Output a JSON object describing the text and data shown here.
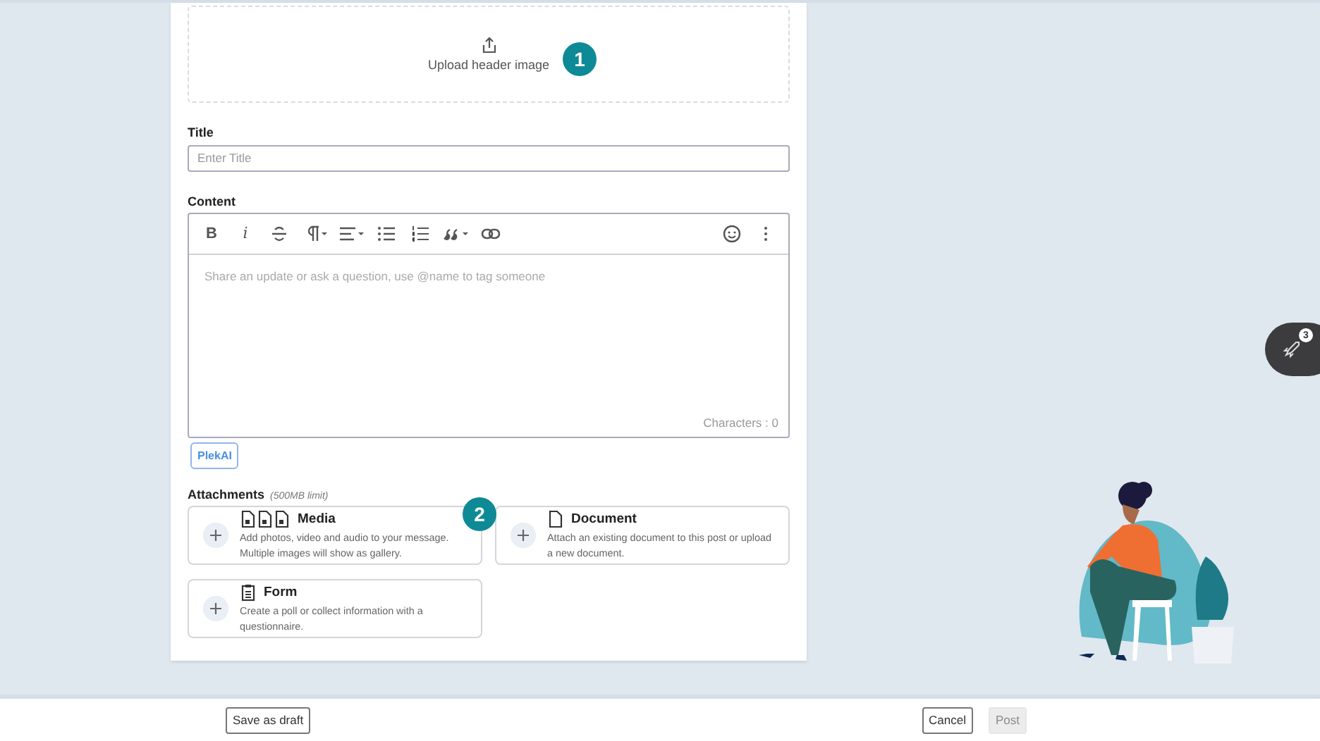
{
  "upload": {
    "label": "Upload header image",
    "step": "1"
  },
  "title_field": {
    "label": "Title",
    "placeholder": "Enter Title"
  },
  "content": {
    "label": "Content",
    "toolbar": [
      {
        "kind": "bold",
        "label": "B"
      },
      {
        "kind": "italic",
        "label": "i"
      },
      {
        "kind": "strike"
      },
      {
        "kind": "paragraph"
      },
      {
        "kind": "align"
      },
      {
        "kind": "bullets"
      },
      {
        "kind": "numbers"
      },
      {
        "kind": "quote"
      },
      {
        "kind": "link"
      },
      {
        "kind": "emoji"
      },
      {
        "kind": "more"
      }
    ],
    "placeholder": "Share an update or ask a question, use @name to tag someone",
    "counter": "Characters : 0"
  },
  "ai_button": "PlekAI",
  "attachments": {
    "label": "Attachments",
    "note": "(500MB limit)",
    "step": "2",
    "items": [
      {
        "kind": "media",
        "title": "Media",
        "description": "Add photos, video and audio to your message. Multiple images will show as gallery."
      },
      {
        "kind": "document",
        "title": "Document",
        "description": "Attach an existing document to this post or upload a new document."
      },
      {
        "kind": "form",
        "title": "Form",
        "description": "Create a poll or collect information with a questionnaire."
      }
    ]
  },
  "rocket": {
    "badge": "3"
  },
  "footer": {
    "save": "Save as draft",
    "cancel": "Cancel",
    "post": {
      "label": "Post",
      "disabled": true
    }
  }
}
